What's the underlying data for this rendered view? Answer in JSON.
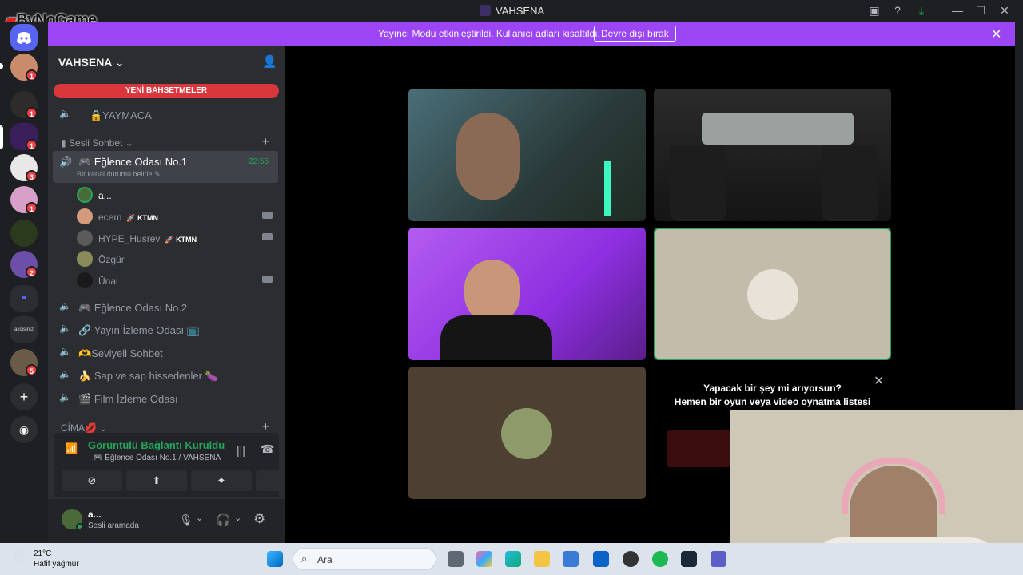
{
  "window": {
    "title": "VAHSENA",
    "watermark": "ByNoGame"
  },
  "banner": {
    "message": "Yayıncı Modu etkinleştirildi. Kullanıcı adları kısaltıldı.",
    "disable_button": "Devre dışı bırak"
  },
  "servers": {
    "badges": [
      "1",
      "1",
      "1",
      "3",
      "1",
      "2",
      "5"
    ],
    "folder_label": "akcısınız"
  },
  "guild": {
    "name": "VAHSENA",
    "new_mentions": "YENİ BAHSETMELER",
    "top_channel": "🔒YAYMACA",
    "category_1": "Sesli Sohbet",
    "category_2": "CİMA💋"
  },
  "active_channel": {
    "name": "Eğlence Odası No.1",
    "timer": "22:55",
    "status_hint": "Bir kanal durumu belirle"
  },
  "voice_users": [
    {
      "name": "a...",
      "tag": ""
    },
    {
      "name": "ecem",
      "tag": "KTMN"
    },
    {
      "name": "HYPE_Husrev",
      "tag": "KTMN"
    },
    {
      "name": "Özgür",
      "tag": ""
    },
    {
      "name": "Ünal",
      "tag": ""
    }
  ],
  "channels": [
    "Eğlence Odası No.2",
    "Yayın İzleme Odası",
    "Seviyeli Sohbet",
    "Sap ve sap hissedenler",
    "Film İzleme Odası"
  ],
  "voice_panel": {
    "status": "Görüntülü Bağlantı Kuruldu",
    "channel": "Eğlence Odası No.1 / VAHSENA"
  },
  "user_panel": {
    "name": "a...",
    "status": "Sesli aramada"
  },
  "activity_card": {
    "title": "Yapacak bir şey mi arıyorsun?",
    "subtitle": "Hemen bir oyun veya video oynatma listesi"
  },
  "taskbar": {
    "temperature": "21°C",
    "weather": "Hafif yağmur",
    "search_placeholder": "Ara"
  },
  "colors": {
    "accent_purple": "#9b45f5",
    "online_green": "#23a55a",
    "mention_red": "#da373c"
  }
}
